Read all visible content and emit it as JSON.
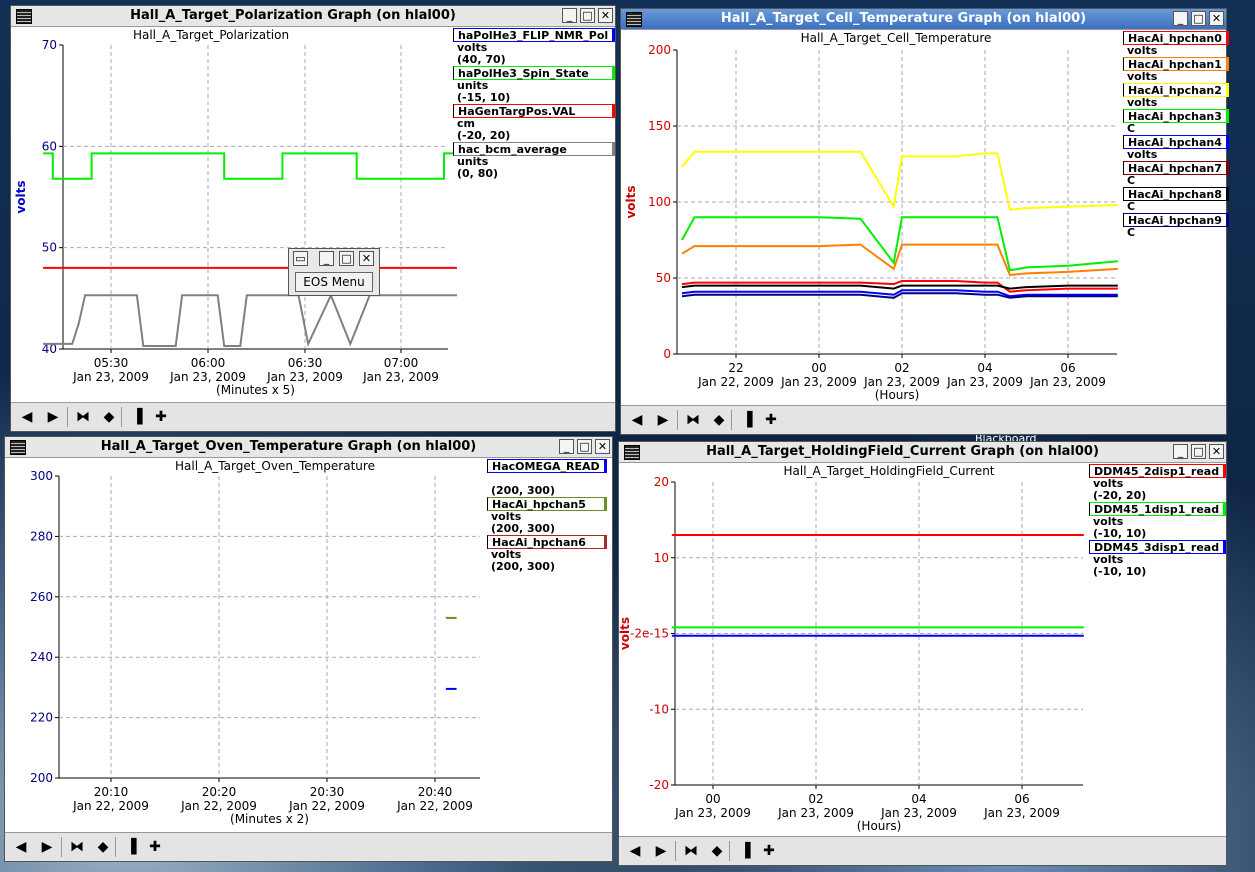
{
  "desktop": {
    "bg_label": "Blackboard"
  },
  "windows": {
    "polarization": {
      "title": "Hall_A_Target_Polarization Graph (on hlal00)",
      "chart_title": "Hall_A_Target_Polarization",
      "ylabel": "volts",
      "yticks": [
        "70",
        "60",
        "50",
        "40"
      ],
      "xticks": [
        {
          "time": "05:30",
          "date": "Jan 23, 2009"
        },
        {
          "time": "06:00",
          "date": "Jan 23, 2009"
        },
        {
          "time": "06:30",
          "date": "Jan 23, 2009"
        },
        {
          "time": "07:00",
          "date": "Jan 23, 2009"
        }
      ],
      "xlabel": "(Minutes x 5)",
      "legend": [
        {
          "name": "haPolHe3_FLIP_NMR_Pol",
          "unit": "volts",
          "range": "(40, 70)",
          "color": "#0000ff"
        },
        {
          "name": "haPolHe3_Spin_State",
          "unit": "units",
          "range": "(-15, 10)",
          "color": "#00ee00"
        },
        {
          "name": "HaGenTargPos.VAL",
          "unit": "cm",
          "range": "(-20, 20)",
          "color": "#ff0000"
        },
        {
          "name": "hac_bcm_average",
          "unit": "units",
          "range": "(0, 80)",
          "color": "#808080"
        }
      ]
    },
    "cell": {
      "title": "Hall_A_Target_Cell_Temperature Graph (on hlal00)",
      "chart_title": "Hall_A_Target_Cell_Temperature",
      "ylabel": "volts",
      "yticks": [
        "200",
        "150",
        "100",
        "50",
        "0"
      ],
      "xticks": [
        {
          "time": "22",
          "date": "Jan 22, 2009"
        },
        {
          "time": "00",
          "date": "Jan 23, 2009"
        },
        {
          "time": "02",
          "date": "Jan 23, 2009"
        },
        {
          "time": "04",
          "date": "Jan 23, 2009"
        },
        {
          "time": "06",
          "date": "Jan 23, 2009"
        }
      ],
      "xlabel": "(Hours)",
      "legend": [
        {
          "name": "HacAi_hpchan0",
          "unit": "volts",
          "color": "#ff0000"
        },
        {
          "name": "HacAi_hpchan1",
          "unit": "volts",
          "color": "#ff8000"
        },
        {
          "name": "HacAi_hpchan2",
          "unit": "volts",
          "color": "#ffff00"
        },
        {
          "name": "HacAi_hpchan3",
          "unit": "C",
          "color": "#00ee00"
        },
        {
          "name": "HacAi_hpchan4",
          "unit": "volts",
          "color": "#0000ff"
        },
        {
          "name": "HacAi_hpchan7",
          "unit": "C",
          "color": "#800000"
        },
        {
          "name": "HacAi_hpchan8",
          "unit": "C",
          "color": "#000000"
        },
        {
          "name": "HacAi_hpchan9",
          "unit": "C",
          "color": "#000080"
        }
      ]
    },
    "oven": {
      "title": "Hall_A_Target_Oven_Temperature Graph (on hlal00)",
      "chart_title": "Hall_A_Target_Oven_Temperature",
      "yticks": [
        "300",
        "280",
        "260",
        "240",
        "220",
        "200"
      ],
      "xticks": [
        {
          "time": "20:10",
          "date": "Jan 22, 2009"
        },
        {
          "time": "20:20",
          "date": "Jan 22, 2009"
        },
        {
          "time": "20:30",
          "date": "Jan 22, 2009"
        },
        {
          "time": "20:40",
          "date": "Jan 22, 2009"
        }
      ],
      "xlabel": "(Minutes x 2)",
      "legend": [
        {
          "name": "HacOMEGA_READ",
          "unit": "",
          "range": "(200, 300)",
          "color": "#0000ff"
        },
        {
          "name": "HacAi_hpchan5",
          "unit": "volts",
          "range": "(200, 300)",
          "color": "#6b8e23"
        },
        {
          "name": "HacAi_hpchan6",
          "unit": "volts",
          "range": "(200, 300)",
          "color": "#a52a2a"
        }
      ]
    },
    "holding": {
      "title": "Hall_A_Target_HoldingField_Current Graph (on hlal00)",
      "chart_title": "Hall_A_Target_HoldingField_Current",
      "ylabel": "volts",
      "yticks": [
        "20",
        "10",
        "-2e-15",
        "-10",
        "-20"
      ],
      "xticks": [
        {
          "time": "00",
          "date": "Jan 23, 2009"
        },
        {
          "time": "02",
          "date": "Jan 23, 2009"
        },
        {
          "time": "04",
          "date": "Jan 23, 2009"
        },
        {
          "time": "06",
          "date": "Jan 23, 2009"
        }
      ],
      "xlabel": "(Hours)",
      "legend": [
        {
          "name": "DDM45_2disp1_read",
          "unit": "volts",
          "range": "(-20, 20)",
          "color": "#ff0000"
        },
        {
          "name": "DDM45_1disp1_read",
          "unit": "volts",
          "range": "(-10, 10)",
          "color": "#00ee00"
        },
        {
          "name": "DDM45_3disp1_read",
          "unit": "volts",
          "range": "(-10, 10)",
          "color": "#0000ff"
        }
      ]
    }
  },
  "eos_menu": {
    "label": "EOS Menu"
  },
  "chart_data": [
    {
      "type": "line",
      "title": "Hall_A_Target_Polarization",
      "ylabel": "volts",
      "ylim": [
        40,
        70
      ],
      "series": [
        {
          "name": "haPolHe3_Spin_State",
          "color": "#00ee00",
          "x": [
            "05:09",
            "05:12",
            "05:12",
            "05:24",
            "05:24",
            "06:05",
            "06:05",
            "06:23",
            "06:23",
            "06:46",
            "06:46",
            "07:13",
            "07:13",
            "07:17"
          ],
          "values": [
            59.3,
            59.3,
            56.8,
            56.8,
            59.3,
            59.3,
            56.8,
            56.8,
            59.3,
            59.3,
            56.8,
            56.8,
            59.3,
            59.3
          ]
        },
        {
          "name": "HaGenTargPos.VAL",
          "color": "#ff0000",
          "x": [
            "05:09",
            "07:17"
          ],
          "values": [
            48.0,
            48.0
          ]
        },
        {
          "name": "hac_bcm_average",
          "color": "#808080",
          "x": [
            "05:09",
            "05:18",
            "05:20",
            "05:22",
            "05:38",
            "05:40",
            "05:50",
            "05:52",
            "06:03",
            "06:05",
            "06:10",
            "06:12",
            "06:28",
            "06:31",
            "06:38",
            "06:44",
            "06:50",
            "07:17"
          ],
          "values": [
            40.5,
            40.5,
            42.5,
            45.3,
            45.3,
            40.3,
            40.3,
            45.3,
            45.3,
            40.3,
            40.3,
            45.3,
            45.3,
            40.5,
            45.3,
            40.5,
            45.3,
            45.3
          ]
        }
      ]
    },
    {
      "type": "line",
      "title": "Hall_A_Target_Cell_Temperature",
      "ylabel": "volts",
      "ylim": [
        0,
        200
      ],
      "x": [
        "20.7",
        "21.0",
        "21.5",
        "22",
        "23",
        "00",
        "01",
        "01.8",
        "02",
        "03",
        "03.3",
        "04",
        "04.3",
        "04.6",
        "05",
        "06",
        "07.2"
      ],
      "series": [
        {
          "name": "HacAi_hpchan2",
          "color": "#ffff00",
          "values": [
            123,
            133,
            133,
            133,
            133,
            133,
            133,
            97,
            130,
            130,
            130,
            132,
            132,
            95,
            96,
            97,
            98
          ]
        },
        {
          "name": "HacAi_hpchan3",
          "color": "#00ee00",
          "values": [
            75,
            90,
            90,
            90,
            90,
            90,
            89,
            60,
            90,
            90,
            90,
            90,
            90,
            55,
            57,
            58,
            61
          ]
        },
        {
          "name": "HacAi_hpchan1",
          "color": "#ff8000",
          "values": [
            66,
            71,
            71,
            71,
            71,
            71,
            72,
            56,
            72,
            72,
            72,
            72,
            72,
            52,
            53,
            54,
            56
          ]
        },
        {
          "name": "HacAi_hpchan0",
          "color": "#ff0000",
          "values": [
            46,
            47,
            47,
            47,
            47,
            47,
            47,
            46,
            48,
            48,
            48,
            47,
            47,
            41,
            42,
            43,
            43
          ]
        },
        {
          "name": "HacAi_hpchan8",
          "color": "#000000",
          "values": [
            44,
            45,
            45,
            45,
            45,
            45,
            45,
            43,
            45,
            45,
            45,
            45,
            45,
            43,
            44,
            45,
            45
          ]
        },
        {
          "name": "HacAi_hpchan4",
          "color": "#0000ff",
          "values": [
            40,
            41,
            41,
            41,
            41,
            41,
            41,
            39,
            42,
            42,
            42,
            41,
            41,
            38,
            39,
            39,
            39
          ]
        },
        {
          "name": "HacAi_hpchan9",
          "color": "#000080",
          "values": [
            38,
            39,
            39,
            39,
            39,
            39,
            39,
            37,
            40,
            40,
            40,
            39,
            39,
            37,
            38,
            38,
            38
          ]
        }
      ]
    },
    {
      "type": "line",
      "title": "Hall_A_Target_Oven_Temperature",
      "ylim": [
        200,
        300
      ],
      "series": [
        {
          "name": "HacAi_hpchan5",
          "color": "#6b8e23",
          "x": [
            "20:41",
            "20:42"
          ],
          "values": [
            253,
            253
          ]
        },
        {
          "name": "HacOMEGA_READ",
          "color": "#0000ff",
          "x": [
            "20:41",
            "20:42"
          ],
          "values": [
            229.5,
            229.5
          ]
        }
      ]
    },
    {
      "type": "line",
      "title": "Hall_A_Target_HoldingField_Current",
      "ylabel": "volts",
      "ylim": [
        -20,
        20
      ],
      "series": [
        {
          "name": "DDM45_2disp1_read",
          "color": "#ff0000",
          "x": [
            "23.2",
            "07.2"
          ],
          "values": [
            13,
            13
          ]
        },
        {
          "name": "DDM45_1disp1_read",
          "color": "#00ee00",
          "x": [
            "23.2",
            "07.2"
          ],
          "values": [
            0.8,
            0.8
          ]
        },
        {
          "name": "DDM45_3disp1_read",
          "color": "#0000ff",
          "x": [
            "23.2",
            "07.2"
          ],
          "values": [
            -0.3,
            -0.3
          ]
        }
      ]
    }
  ]
}
